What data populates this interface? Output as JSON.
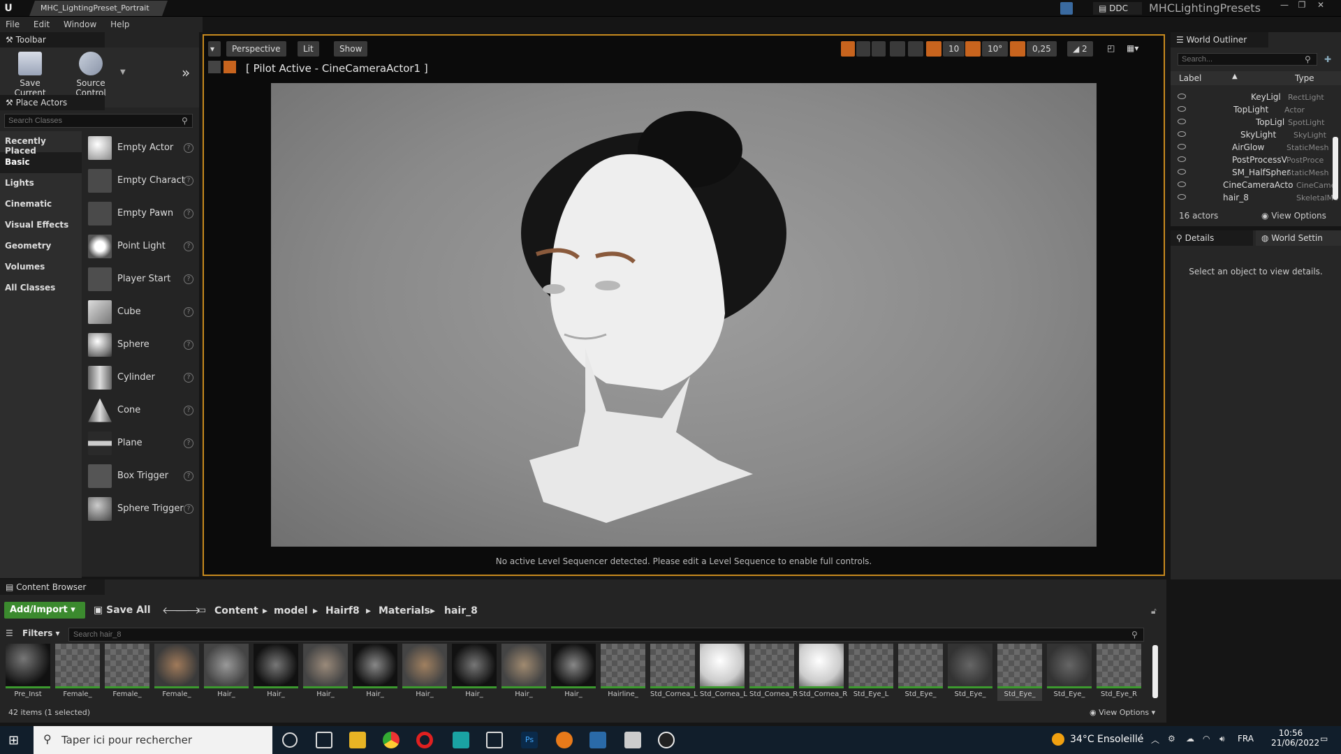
{
  "titlebar": {
    "app_logo": "ue4-logo-icon",
    "level_tab": "MHC_LightingPreset_Portrait",
    "ddc_label": "DDC",
    "project_name": "MHCLightingPresets"
  },
  "menu": [
    "File",
    "Edit",
    "Window",
    "Help"
  ],
  "toolbar_panel": {
    "tab_label": "Toolbar",
    "save_current": "Save Current",
    "source_control": "Source Control"
  },
  "place_actors": {
    "tab_label": "Place Actors",
    "search_placeholder": "Search Classes",
    "categories": [
      "Recently Placed",
      "Basic",
      "Lights",
      "Cinematic",
      "Visual Effects",
      "Geometry",
      "Volumes",
      "All Classes"
    ],
    "active_category": "Basic",
    "actors": [
      "Empty Actor",
      "Empty Charact",
      "Empty Pawn",
      "Point Light",
      "Player Start",
      "Cube",
      "Sphere",
      "Cylinder",
      "Cone",
      "Plane",
      "Box Trigger",
      "Sphere Trigger"
    ]
  },
  "viewport": {
    "perspective": "Perspective",
    "lit": "Lit",
    "show": "Show",
    "grid_snap": "10",
    "rotation_snap": "10°",
    "scale_snap": "0,25",
    "camera_speed": "2",
    "pilot_label": "[ Pilot Active - CineCameraActor1 ]",
    "sequencer_message": "No active Level Sequencer detected. Please edit a Level Sequence to enable full controls."
  },
  "world_outliner": {
    "tab_label": "World Outliner",
    "search_placeholder": "Search...",
    "col_label": "Label",
    "col_type": "Type",
    "rows": [
      {
        "label": "KeyLigl",
        "type": "RectLight"
      },
      {
        "label": "TopLight",
        "type": "Actor"
      },
      {
        "label": "TopLigl",
        "type": "SpotLight"
      },
      {
        "label": "SkyLight",
        "type": "SkyLight"
      },
      {
        "label": "AirGlow",
        "type": "StaticMesh"
      },
      {
        "label": "PostProcessV",
        "type": "PostProce"
      },
      {
        "label": "SM_HalfSpher",
        "type": "StaticMesh"
      },
      {
        "label": "CineCameraActo",
        "type": "CineCame"
      },
      {
        "label": "hair_8",
        "type": "SkeletalMe"
      }
    ],
    "actor_count": "16 actors",
    "view_options": "View Options"
  },
  "details": {
    "tab_label": "Details",
    "world_settings_tab": "World Settin",
    "empty_message": "Select an object to view details."
  },
  "content_browser": {
    "tab_label": "Content Browser",
    "add_import": "Add/Import",
    "save_all": "Save All",
    "breadcrumb": [
      "Content",
      "model",
      "Hairf8",
      "Materials",
      "hair_8"
    ],
    "filters": "Filters",
    "search_placeholder": "Search hair_8",
    "assets": [
      "Pre_Inst",
      "Female_",
      "Female_",
      "Female_",
      "Hair_",
      "Hair_",
      "Hair_",
      "Hair_",
      "Hair_",
      "Hair_",
      "Hair_",
      "Hair_",
      "Hairline_",
      "Std_Cornea_L",
      "Std_Cornea_L",
      "Std_Cornea_R",
      "Std_Cornea_R",
      "Std_Eye_L",
      "Std_Eye_",
      "Std_Eye_",
      "Std_Eye_",
      "Std_Eye_",
      "Std_Eye_R"
    ],
    "item_count": "42 items (1 selected)",
    "view_options": "View Options"
  },
  "taskbar": {
    "search_text": "Taper ici pour rechercher",
    "weather": "34°C  Ensoleillé",
    "language": "FRA",
    "time": "10:56",
    "date": "21/06/2022"
  }
}
